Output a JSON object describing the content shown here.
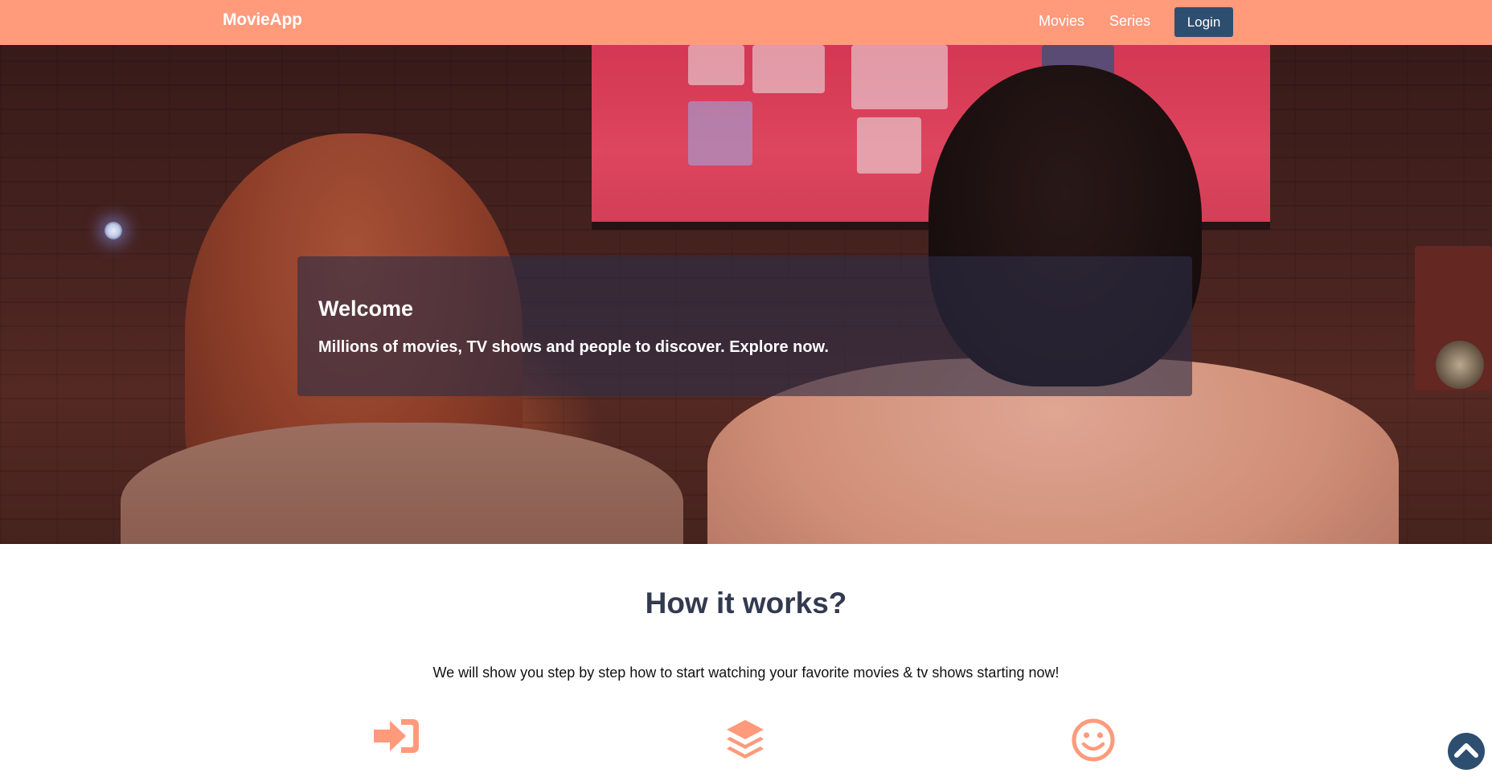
{
  "navbar": {
    "brand": "MovieApp",
    "links": [
      {
        "label": "Movies"
      },
      {
        "label": "Series"
      }
    ],
    "login_label": "Login",
    "background": "#ff9a7b",
    "login_color": "#2d4e6f"
  },
  "hero": {
    "title": "Welcome",
    "subtitle": "Millions of movies, TV shows and people to discover. Explore now."
  },
  "how_it_works": {
    "title": "How it works?",
    "description": "We will show you step by step how to start watching your favorite movies & tv shows starting now!",
    "icons": [
      "sign-in-icon",
      "layers-icon",
      "smile-icon"
    ],
    "icon_color": "#ff9a7b"
  },
  "scroll_top": {
    "icon": "chevron-up-icon"
  }
}
